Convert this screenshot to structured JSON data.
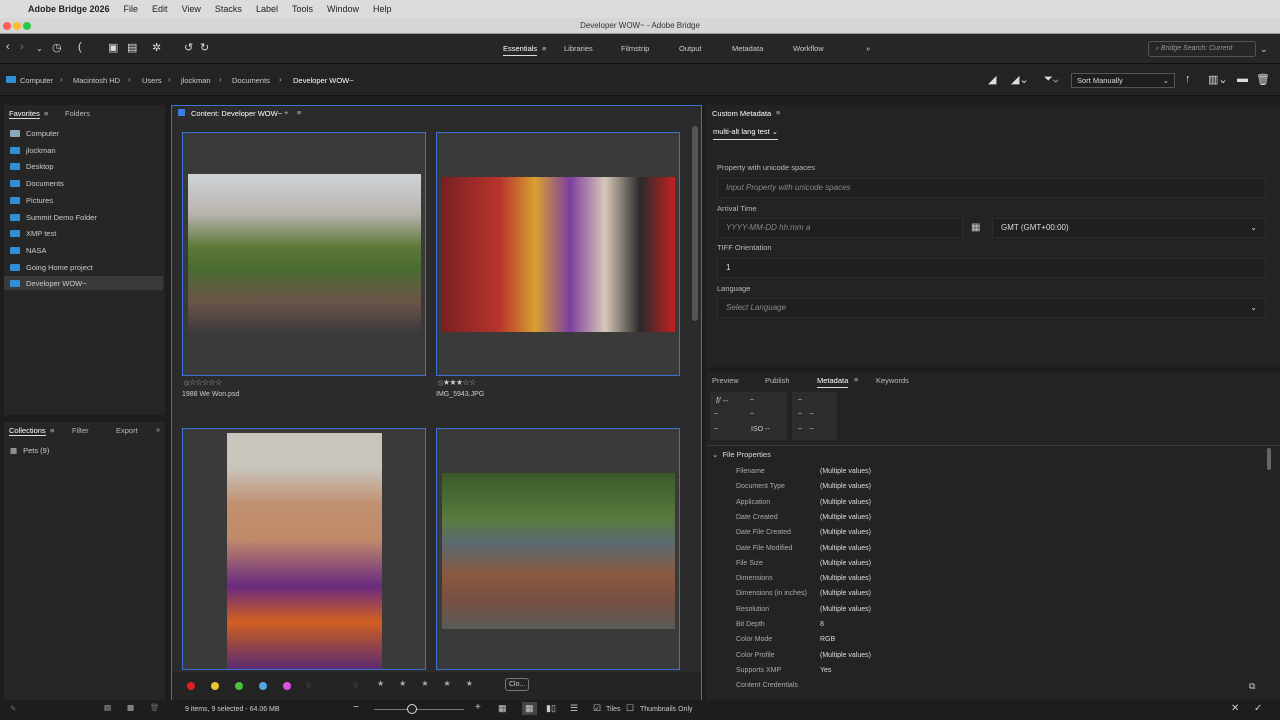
{
  "menubar": {
    "app": "Adobe Bridge 2026",
    "items": [
      "File",
      "Edit",
      "View",
      "Stacks",
      "Label",
      "Tools",
      "Window",
      "Help"
    ]
  },
  "window_title": "Developer WOW~ - Adobe Bridge",
  "workspaces": [
    "Essentials",
    "Libraries",
    "Filmstrip",
    "Output",
    "Metadata",
    "Workflow"
  ],
  "search_placeholder": "Bridge Search: Current",
  "path": [
    "Computer",
    "Macintosh HD",
    "Users",
    "jlockman",
    "Documents",
    "Developer WOW~"
  ],
  "sort": "Sort Manually",
  "left_tabs": [
    "Favorites",
    "Folders"
  ],
  "favorites": [
    "Computer",
    "jlockman",
    "Desktop",
    "Documents",
    "Pictures",
    "Summit Demo Folder",
    "XMP test",
    "NASA",
    "Going Home project",
    "Developer WOW~"
  ],
  "collections_tabs": [
    "Collections",
    "Filter",
    "Export"
  ],
  "collections": [
    "Pets (9)"
  ],
  "content_title": "Content: Developer WOW~",
  "thumbs": [
    {
      "name": "1988 We Won.psd",
      "rating": 0
    },
    {
      "name": "IMG_5943.JPG",
      "rating": 3
    }
  ],
  "filter_button": "Clo...",
  "status": "9 items, 9 selected - 64.06 MB",
  "view_opts": {
    "tiles": "Tiles",
    "thumbs_only": "Thumbnails Only"
  },
  "custom_metadata": {
    "title": "Custom Metadata",
    "schema": "multi-alt lang test",
    "fields": [
      {
        "label": "Property with unicode spaces",
        "placeholder": "Input Property with unicode spaces"
      },
      {
        "label": "Arrival Time",
        "placeholder": "YYYY-MM-DD hh:mm a",
        "tz": "GMT (GMT+00:00)"
      },
      {
        "label": "TIFF Orientation",
        "value": "1"
      },
      {
        "label": "Language",
        "placeholder": "Select Language"
      }
    ]
  },
  "lower_tabs": [
    "Preview",
    "Publish",
    "Metadata",
    "Keywords"
  ],
  "camera": {
    "f": "f/ --",
    "iso": "ISO --"
  },
  "file_props_title": "File Properties",
  "file_props": [
    [
      "Filename",
      "(Multiple values)"
    ],
    [
      "Document Type",
      "(Multiple values)"
    ],
    [
      "Application",
      "(Multiple values)"
    ],
    [
      "Date Created",
      "(Multiple values)"
    ],
    [
      "Date File Created",
      "(Multiple values)"
    ],
    [
      "Date File Modified",
      "(Multiple values)"
    ],
    [
      "File Size",
      "(Multiple values)"
    ],
    [
      "Dimensions",
      "(Multiple values)"
    ],
    [
      "Dimensions (in inches)",
      "(Multiple values)"
    ],
    [
      "Resolution",
      "(Multiple values)"
    ],
    [
      "Bit Depth",
      "8"
    ],
    [
      "Color Mode",
      "RGB"
    ],
    [
      "Color Profile",
      "(Multiple values)"
    ],
    [
      "Supports XMP",
      "Yes"
    ],
    [
      "Content Credentials",
      ""
    ]
  ],
  "label_colors": [
    "#e02020",
    "#e8c830",
    "#4cc040",
    "#50a8e8",
    "#e050e0"
  ]
}
